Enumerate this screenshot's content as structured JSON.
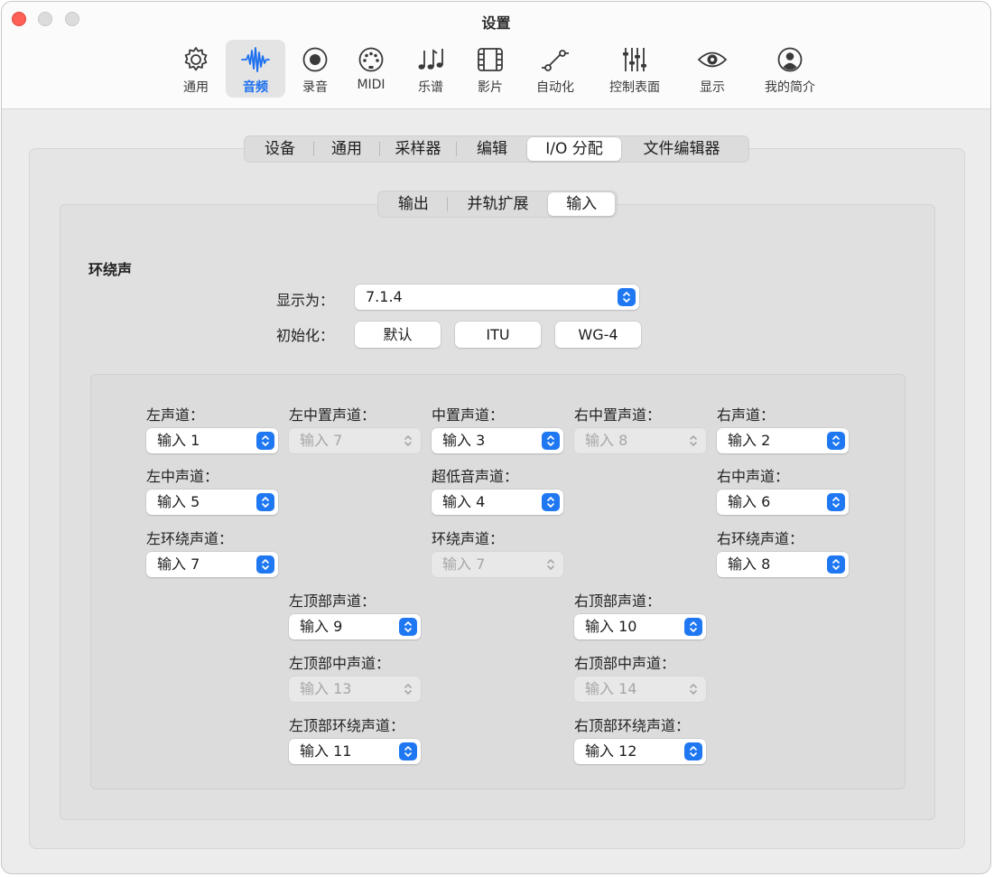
{
  "window": {
    "title": "设置"
  },
  "toolbar": {
    "items": [
      {
        "label": "通用",
        "icon": "gear-icon",
        "active": false
      },
      {
        "label": "音频",
        "icon": "waveform-icon",
        "active": true
      },
      {
        "label": "录音",
        "icon": "record-icon",
        "active": false
      },
      {
        "label": "MIDI",
        "icon": "midi-port-icon",
        "active": false
      },
      {
        "label": "乐谱",
        "icon": "music-notes-icon",
        "active": false
      },
      {
        "label": "影片",
        "icon": "film-icon",
        "active": false
      },
      {
        "label": "自动化",
        "icon": "automation-icon",
        "active": false
      },
      {
        "label": "控制表面",
        "icon": "sliders-icon",
        "active": false
      },
      {
        "label": "显示",
        "icon": "eye-icon",
        "active": false
      },
      {
        "label": "我的简介",
        "icon": "profile-icon",
        "active": false
      }
    ]
  },
  "tabs": {
    "items": [
      "设备",
      "通用",
      "采样器",
      "编辑",
      "I/O 分配",
      "文件编辑器"
    ],
    "active": "I/O 分配"
  },
  "subtabs": {
    "items": [
      "输出",
      "并轨扩展",
      "输入"
    ],
    "active": "输入"
  },
  "surround": {
    "heading": "环绕声",
    "display_as_label": "显示为：",
    "display_as_value": "7.1.4",
    "init_label": "初始化：",
    "init_buttons": [
      "默认",
      "ITU",
      "WG-4"
    ]
  },
  "channels": {
    "left": {
      "label": "左声道：",
      "value": "输入 1",
      "enabled": true
    },
    "left_center": {
      "label": "左中置声道：",
      "value": "输入 7",
      "enabled": false
    },
    "center": {
      "label": "中置声道：",
      "value": "输入 3",
      "enabled": true
    },
    "right_center": {
      "label": "右中置声道：",
      "value": "输入 8",
      "enabled": false
    },
    "right": {
      "label": "右声道：",
      "value": "输入 2",
      "enabled": true
    },
    "left_mid": {
      "label": "左中声道：",
      "value": "输入 5",
      "enabled": true
    },
    "lfe": {
      "label": "超低音声道：",
      "value": "输入 4",
      "enabled": true
    },
    "right_mid": {
      "label": "右中声道：",
      "value": "输入 6",
      "enabled": true
    },
    "left_surround": {
      "label": "左环绕声道：",
      "value": "输入 7",
      "enabled": true
    },
    "surround": {
      "label": "环绕声道：",
      "value": "输入 7",
      "enabled": false
    },
    "right_surround": {
      "label": "右环绕声道：",
      "value": "输入 8",
      "enabled": true
    },
    "left_top": {
      "label": "左顶部声道：",
      "value": "输入 9",
      "enabled": true
    },
    "right_top": {
      "label": "右顶部声道：",
      "value": "输入 10",
      "enabled": true
    },
    "left_top_mid": {
      "label": "左顶部中声道：",
      "value": "输入 13",
      "enabled": false
    },
    "right_top_mid": {
      "label": "右顶部中声道：",
      "value": "输入 14",
      "enabled": false
    },
    "left_top_surround": {
      "label": "左顶部环绕声道：",
      "value": "输入 11",
      "enabled": true
    },
    "right_top_surround": {
      "label": "右顶部环绕声道：",
      "value": "输入 12",
      "enabled": true
    }
  },
  "colors": {
    "accent": "#1f78f2",
    "close": "#fe5f57"
  }
}
